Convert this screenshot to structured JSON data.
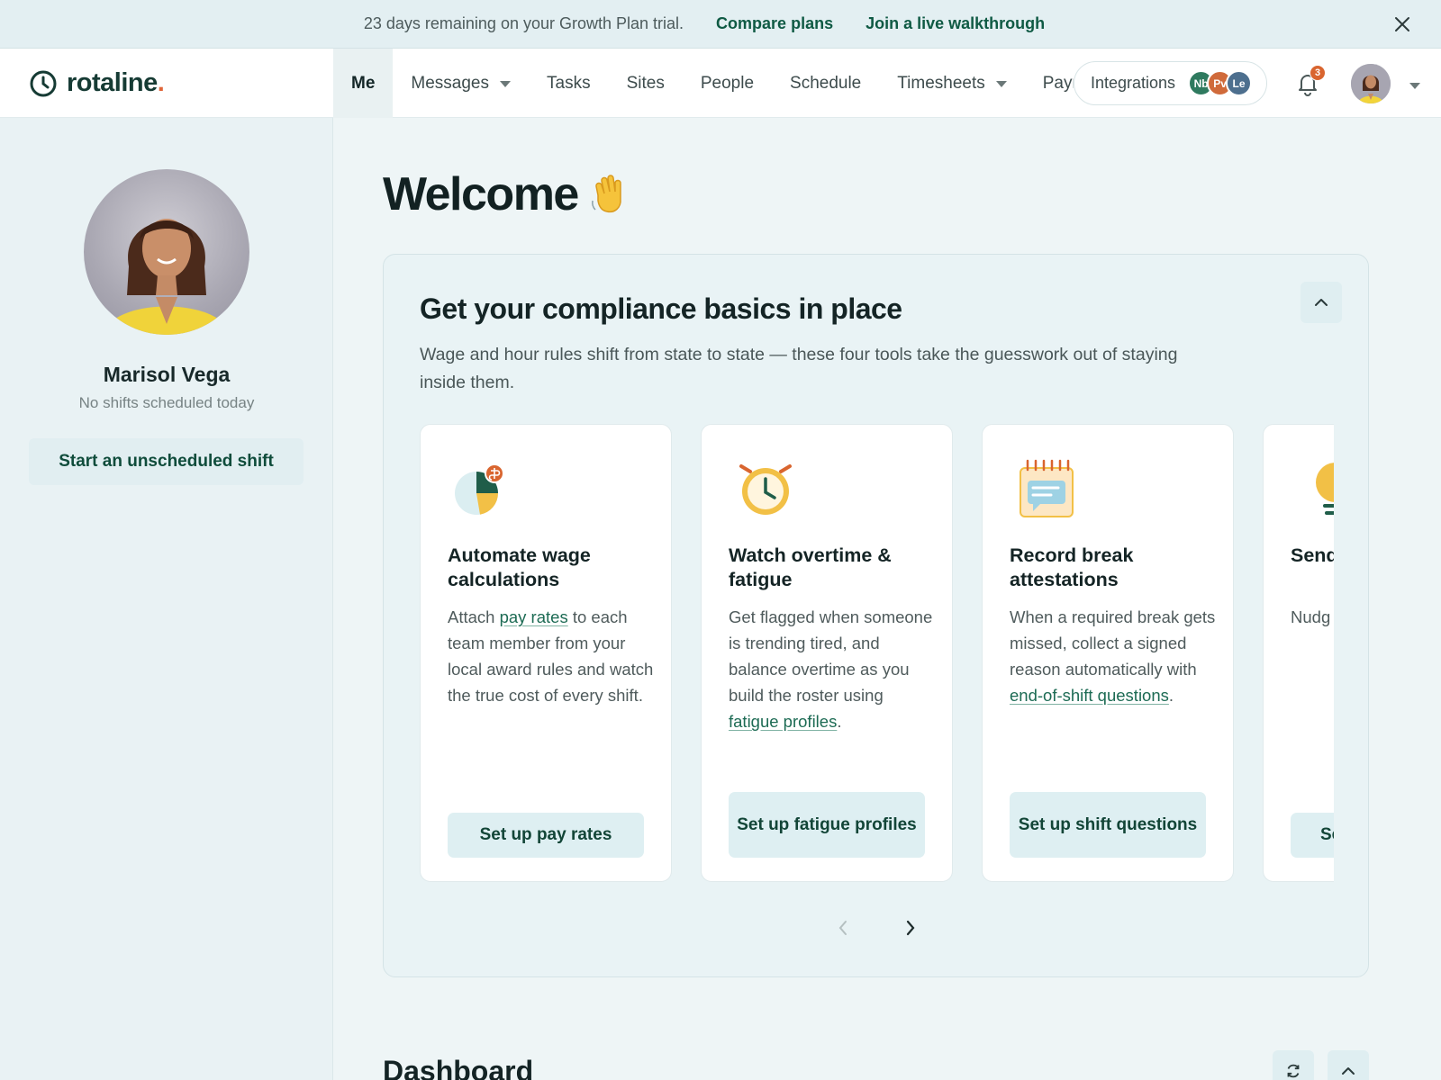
{
  "banner": {
    "trial_text": "23 days remaining on your Growth Plan trial.",
    "compare_plans": "Compare plans",
    "walkthrough": "Join a live walkthrough"
  },
  "nav": {
    "logo_text": "rotaline",
    "logo_dot": ".",
    "tabs": [
      {
        "label": "Me",
        "active": true
      },
      {
        "label": "Messages"
      },
      {
        "label": "Tasks"
      },
      {
        "label": "Sites"
      },
      {
        "label": "People"
      },
      {
        "label": "Schedule"
      },
      {
        "label": "Timesheets"
      },
      {
        "label": "Payr"
      }
    ],
    "integrations": {
      "label": "Integrations",
      "avatars": [
        {
          "initials": "Nb",
          "color": "#2f7a5f"
        },
        {
          "initials": "Pv",
          "color": "#d06a3a"
        },
        {
          "initials": "Le",
          "color": "#4d6f8e"
        }
      ]
    },
    "notifications_count": "3"
  },
  "sidebar": {
    "name": "Marisol Vega",
    "status": "No shifts scheduled today",
    "start_shift": "Start an unscheduled shift"
  },
  "main": {
    "welcome": "Welcome",
    "compliance": {
      "title": "Get your compliance basics in place",
      "description": "Wage and hour rules shift from state to state — these four tools take the guesswork out of staying inside them.",
      "cards": [
        {
          "title": "Automate wage calculations",
          "body_pre": "Attach ",
          "body_link": "pay rates",
          "body_post": " to each team member from your local award rules and watch the true cost of every shift.",
          "button": "Set up pay rates"
        },
        {
          "title": "Watch overtime & fatigue",
          "body_pre": "Get flagged when someone is trending tired, and balance overtime as you build the roster using ",
          "body_link": "fatigue profiles",
          "body_post": ".",
          "button": "Set up fatigue profiles"
        },
        {
          "title": "Record break attestations",
          "body_pre": "When a required break gets missed, collect a signed reason automatically with ",
          "body_link": "end-of-shift questions",
          "body_post": ".",
          "button": "Set up shift questions"
        },
        {
          "title": "Send remi",
          "body_pre": "Nudg a rest then I in one",
          "body_link": "",
          "body_post": "",
          "button": "Se"
        }
      ]
    },
    "dashboard_title": "Dashboard"
  },
  "colors": {
    "brand_green": "#0f5a44",
    "accent_orange": "#e0663a",
    "badge": "#d9652f"
  }
}
